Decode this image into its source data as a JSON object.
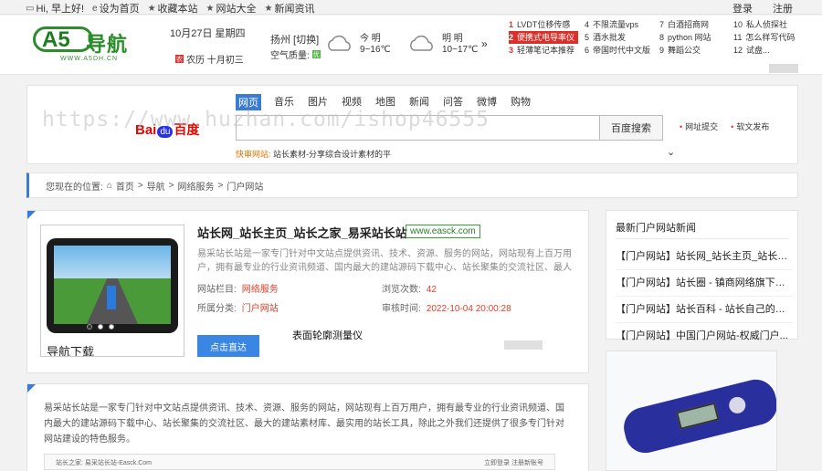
{
  "topbar": {
    "greeting": "Hi, 早上好!",
    "set_home": "设为首页",
    "favorite": "收藏本站",
    "site_all": "网站大全",
    "news": "新闻资讯",
    "login": "登录",
    "register": "注册"
  },
  "logo": {
    "main": "A5",
    "cn": "导航",
    "url": "WWW.A5DH.CN"
  },
  "date": {
    "text": "10月27日 星期四",
    "lunar_badge": "农",
    "lunar": "农历 十月初三"
  },
  "weather": {
    "city": "扬州 [切换]",
    "aqi_label": "空气质量:",
    "aqi_badge": "优",
    "today_label": "今 明",
    "today_temp": "9~16℃",
    "tomorrow_label": "明 明",
    "tomorrow_temp": "10~17℃"
  },
  "hotlist": {
    "col1": [
      {
        "n": "1",
        "t": "LVDT位移传感"
      },
      {
        "n": "2",
        "t": "便携式电导率仪"
      },
      {
        "n": "3",
        "t": "轻薄笔记本推荐"
      }
    ],
    "col2": [
      {
        "n": "4",
        "t": "不限流量vps"
      },
      {
        "n": "5",
        "t": "酒水批发"
      },
      {
        "n": "6",
        "t": "帝国时代中文版"
      }
    ],
    "col3": [
      {
        "n": "7",
        "t": "白酒招商网"
      },
      {
        "n": "8",
        "t": "python 网站"
      },
      {
        "n": "9",
        "t": "舞蹈公交"
      }
    ],
    "col4": [
      {
        "n": "10",
        "t": "私人侦探社"
      },
      {
        "n": "11",
        "t": "怎么样写代码"
      },
      {
        "n": "12",
        "t": "试盘..."
      }
    ]
  },
  "search": {
    "tabs": [
      "网页",
      "音乐",
      "图片",
      "视频",
      "地图",
      "新闻",
      "问答",
      "微博",
      "购物"
    ],
    "engine_bai": "Bai",
    "engine_du": "du",
    "engine_cn": "百度",
    "button": "百度搜索",
    "placeholder": "",
    "link1": "网址提交",
    "link2": "软文发布",
    "quick_label": "快审网站:",
    "quick_text": "站长素材-分享综合设计素材的平",
    "watermark": "https://www.huzhan.com/ishop46555"
  },
  "breadcrumb": {
    "prefix": "您现在的位置:",
    "home": "首页",
    "l1": "导航",
    "l2": "网络服务",
    "l3": "门户网站",
    "sep": ">"
  },
  "site": {
    "title": "站长网_站长主页_站长之家_易采站长站",
    "url": "www.easck.com",
    "desc": "易采站长站是一家专门针对中文站点提供资讯、技术、资源、服务的网站，网站现有上百万用户，拥有最专业的行业资讯频道、国内最大的建站源码下载中心、站长聚集的交流社区、最人",
    "k_column": "网站栏目:",
    "v_column": "网络服务",
    "k_views": "浏览次数:",
    "v_views": "42",
    "k_category": "所属分类:",
    "v_category": "门户网站",
    "k_time": "审核时间:",
    "v_time": "2022-10-04 20:00:28",
    "visit_button": "点击直达",
    "img_caption": "导航下载",
    "img_overlay": "表面轮廓测量仪"
  },
  "intro": {
    "text": "易采站长站是一家专门针对中文站点提供资讯、技术、资源、服务的网站，网站现有上百万用户，拥有最专业的行业资讯频道、国内最大的建站源码下载中心、站长聚集的交流社区、最大的建站素材库、最实用的站长工具，除此之外我们还提供了很多专门针对网站建设的特色服务。",
    "bar_left": "站长之家: 易采站长站-Easck.Com",
    "bar_right": "立即登录 注册新账号"
  },
  "sidebar": {
    "title": "最新门户网站新闻",
    "items": [
      "【门户网站】站长网_站长主页_站长之...",
      "【门户网站】站长圈 - 镇商网络旗下站...",
      "【门户网站】站长百科 - 站长自己的百...",
      "【门户网站】中国门户网站-权威门户..."
    ]
  }
}
